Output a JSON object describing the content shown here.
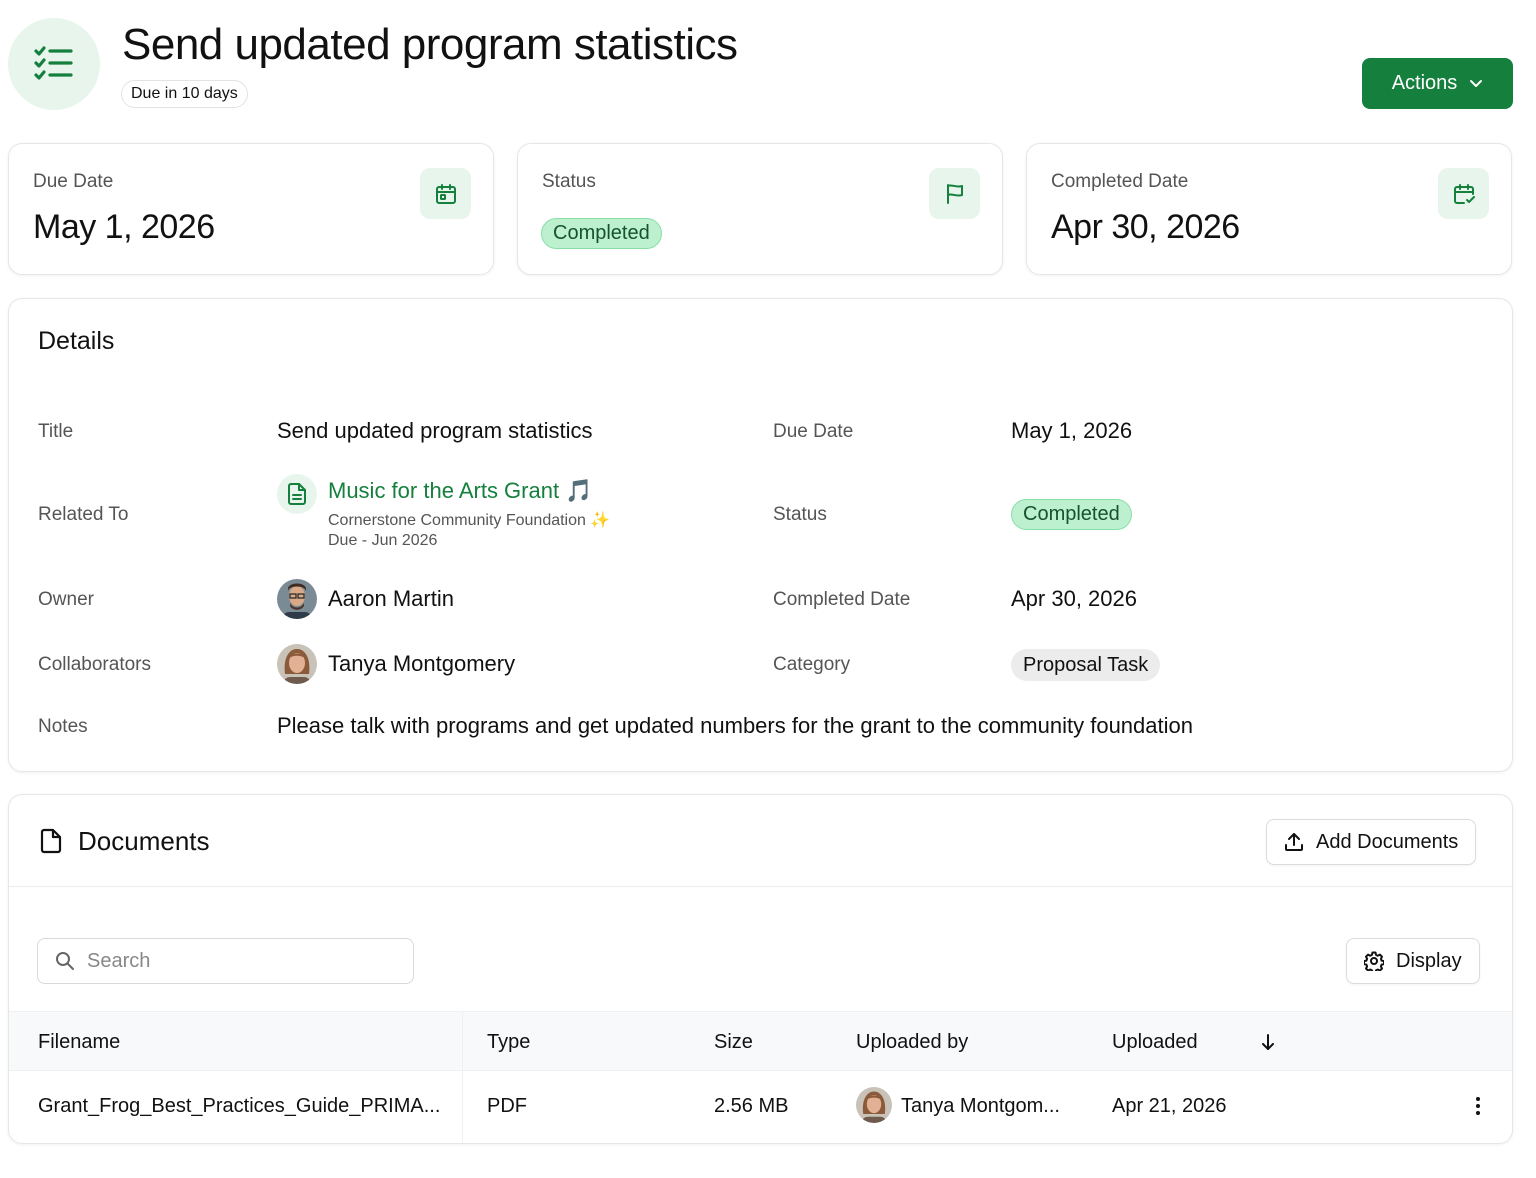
{
  "header": {
    "title": "Send updated program statistics",
    "due_pill": "Due in 10 days",
    "actions_label": "Actions",
    "icon": "checklist-icon"
  },
  "stats": [
    {
      "label": "Due Date",
      "value": "May 1, 2026",
      "icon": "calendar-icon"
    },
    {
      "label": "Status",
      "value": "Completed",
      "icon": "flag-icon"
    },
    {
      "label": "Completed Date",
      "value": "Apr 30, 2026",
      "icon": "calendar-check-icon"
    }
  ],
  "details": {
    "heading": "Details",
    "title_label": "Title",
    "title_value": "Send updated program statistics",
    "related_label": "Related To",
    "related_name": "Music for the Arts Grant",
    "related_emoji": "🎵",
    "related_org": "Cornerstone Community Foundation",
    "related_org_emoji": "✨",
    "related_due": "Due - Jun 2026",
    "owner_label": "Owner",
    "owner_name": "Aaron Martin",
    "collaborators_label": "Collaborators",
    "collaborator_name": "Tanya Montgomery",
    "notes_label": "Notes",
    "notes_value": "Please talk with programs and get updated numbers for the grant to the community foundation",
    "due_label": "Due Date",
    "due_value": "May 1, 2026",
    "status_label": "Status",
    "status_value": "Completed",
    "completed_label": "Completed Date",
    "completed_value": "Apr 30, 2026",
    "category_label": "Category",
    "category_value": "Proposal Task"
  },
  "documents": {
    "heading": "Documents",
    "add_label": "Add Documents",
    "search_placeholder": "Search",
    "display_label": "Display",
    "columns": [
      "Filename",
      "Type",
      "Size",
      "Uploaded by",
      "Uploaded"
    ],
    "rows": [
      {
        "filename": "Grant_Frog_Best_Practices_Guide_PRIMA...",
        "type": "PDF",
        "size": "2.56 MB",
        "uploaded_by": "Tanya Montgom...",
        "uploaded": "Apr 21, 2026"
      }
    ]
  },
  "colors": {
    "accent": "#15803d",
    "accent_soft": "#e8f5ec",
    "badge_green": "#bdf0cf"
  }
}
